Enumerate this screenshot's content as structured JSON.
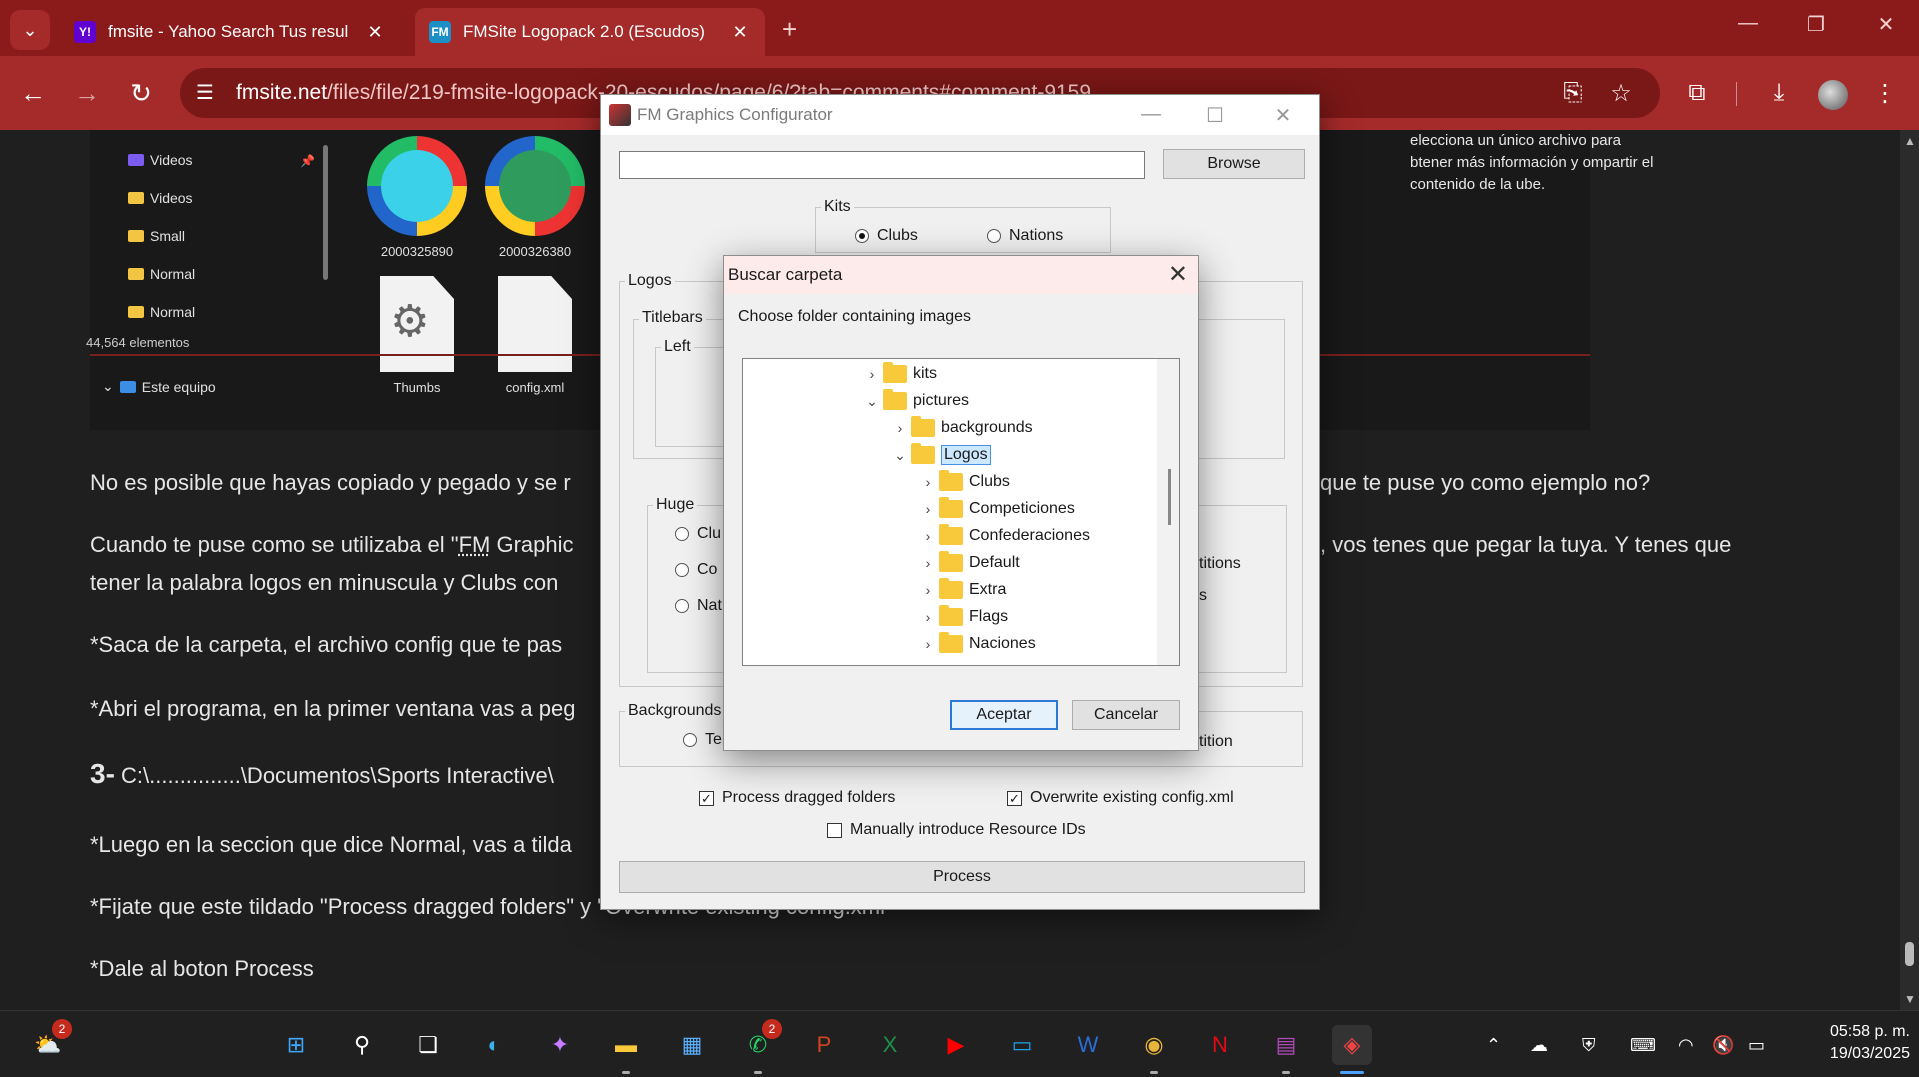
{
  "browser": {
    "tabs": [
      {
        "title": "fmsite - Yahoo Search Tus resul",
        "favicon": "Y!"
      },
      {
        "title": "FMSite Logopack 2.0 (Escudos)",
        "favicon": "FM"
      }
    ],
    "url_host": "fmsite.net",
    "url_path": "/files/file/219-fmsite-logopack-20-escudos/page/6/?tab=comments#comment-9159",
    "accent_color": "#a52a2a"
  },
  "explorer": {
    "nav_items": [
      "Videos",
      "Videos",
      "Small",
      "Normal",
      "Normal",
      "Este equipo"
    ],
    "files": [
      {
        "name": "2000325890"
      },
      {
        "name": "2000326380"
      },
      {
        "name": "Thumbs"
      },
      {
        "name": "config.xml"
      }
    ],
    "status": "44,564 elementos",
    "details_text": "elecciona un único archivo para btener más información y ompartir el contenido de la ube."
  },
  "article": {
    "p1": "No es posible que hayas copiado y pegado y se r",
    "p1_tail": "que te puse yo como ejemplo no?",
    "p2_a": "Cuando te puse como se utilizaba el \"",
    "p2_abbr": "FM",
    "p2_b": " Graphic",
    "p2_tail": ", vos tenes que pegar la tuya. Y tenes que",
    "p3": "tener la palabra logos en minuscula y Clubs con",
    "p4": "*Saca de la carpeta, el archivo config que te pas",
    "p5": "*Abri el programa, en la primer ventana vas a peg",
    "p6_step": "3-",
    "p6": " C:\\...............\\Documentos\\Sports Interactive\\",
    "p7": "*Luego en la seccion que dice Normal, vas a tilda",
    "p8": "*Fijate que este tildado \"Process dragged folders\" y \"Overwrite existing config.xml\"",
    "p9": "*Dale al boton Process"
  },
  "fm_window": {
    "title": "FM Graphics Configurator",
    "browse_label": "Browse",
    "kits_label": "Kits",
    "kits_options": [
      "Clubs",
      "Nations"
    ],
    "logos_label": "Logos",
    "titlebars_label": "Titlebars",
    "left_label": "Left",
    "huge_label": "Huge",
    "huge_options": [
      "Clu",
      "Co",
      "Nat"
    ],
    "competitions_fragment": "titions",
    "s_fragment": "s",
    "backgrounds_label": "Backgrounds",
    "bg_option": "Te",
    "bg_competition_fragment": "tition",
    "process_dragged": "Process dragged folders",
    "overwrite": "Overwrite existing config.xml",
    "manual_ids": "Manually introduce Resource IDs",
    "process_label": "Process"
  },
  "folder_dialog": {
    "title": "Buscar carpeta",
    "instruction": "Choose folder containing images",
    "tree": [
      {
        "label": "kits",
        "expanded": false
      },
      {
        "label": "pictures",
        "expanded": true
      },
      {
        "label": "backgrounds",
        "expanded": false
      },
      {
        "label": "Logos",
        "expanded": true,
        "selected": true
      },
      {
        "label": "Clubs",
        "expanded": false
      },
      {
        "label": "Competiciones",
        "expanded": false
      },
      {
        "label": "Confederaciones",
        "expanded": false
      },
      {
        "label": "Default",
        "expanded": false
      },
      {
        "label": "Extra",
        "expanded": false
      },
      {
        "label": "Flags",
        "expanded": false
      },
      {
        "label": "Naciones",
        "expanded": false
      }
    ],
    "ok_label": "Aceptar",
    "cancel_label": "Cancelar"
  },
  "taskbar": {
    "weather_badge": "2",
    "whatsapp_badge": "2",
    "time": "05:58 p. m.",
    "date": "19/03/2025"
  }
}
